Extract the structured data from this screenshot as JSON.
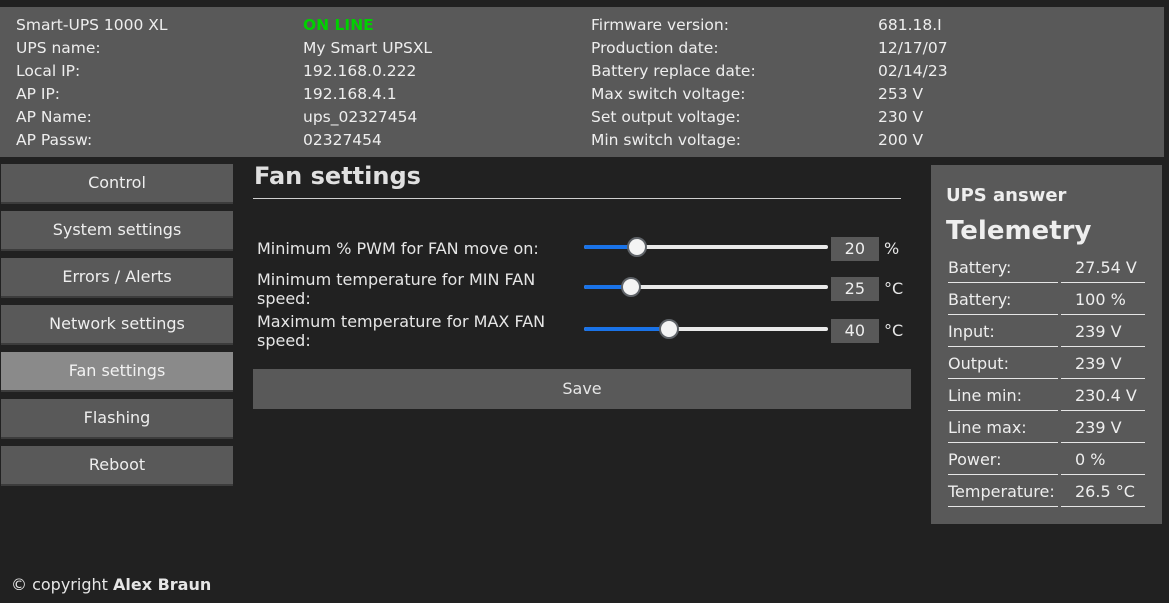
{
  "info": {
    "model": "Smart-UPS 1000 XL",
    "status": "ON LINE",
    "rows": [
      {
        "label": "UPS name:",
        "value": "My Smart UPSXL",
        "label2": "Production date:",
        "value2": "12/17/07"
      },
      {
        "label": "Local IP:",
        "value": "192.168.0.222",
        "label2": "Battery replace date:",
        "value2": "02/14/23"
      },
      {
        "label": "AP IP:",
        "value": "192.168.4.1",
        "label2": "Max switch voltage:",
        "value2": "253 V"
      },
      {
        "label": "AP Name:",
        "value": "ups_02327454",
        "label2": "Set output voltage:",
        "value2": "230 V"
      },
      {
        "label": "AP Passw:",
        "value": "02327454",
        "label2": "Min switch voltage:",
        "value2": "200 V"
      }
    ],
    "firmware_label": "Firmware version:",
    "firmware_value": "681.18.I"
  },
  "menu": [
    {
      "label": "Control"
    },
    {
      "label": "System settings"
    },
    {
      "label": "Errors / Alerts"
    },
    {
      "label": "Network settings"
    },
    {
      "label": "Fan settings",
      "active": true
    },
    {
      "label": "Flashing"
    },
    {
      "label": "Reboot"
    }
  ],
  "fan": {
    "title": "Fan settings",
    "settings": [
      {
        "label": "Minimum % PWM for FAN move on:",
        "value": "20",
        "unit": "%",
        "fraction": 0.217
      },
      {
        "label": "Minimum temperature for MIN FAN speed:",
        "value": "25",
        "unit": "°C",
        "fraction": 0.193
      },
      {
        "label": "Maximum temperature for MAX FAN speed:",
        "value": "40",
        "unit": "°C",
        "fraction": 0.348
      }
    ],
    "save_label": "Save"
  },
  "telemetry": {
    "heading": "UPS answer",
    "title": "Telemetry",
    "rows": [
      {
        "k": "Battery:",
        "v": "27.54 V"
      },
      {
        "k": "Battery:",
        "v": "100 %"
      },
      {
        "k": "Input:",
        "v": "239 V"
      },
      {
        "k": "Output:",
        "v": "239 V"
      },
      {
        "k": "Line min:",
        "v": "230.4 V"
      },
      {
        "k": "Line max:",
        "v": "239 V"
      },
      {
        "k": "Power:",
        "v": "0 %"
      },
      {
        "k": "Temperature:",
        "v": "26.5 °C"
      }
    ]
  },
  "footer": {
    "prefix": "© copyright",
    "author": "Alex Braun"
  },
  "colors": {
    "panel": "#595959",
    "background": "#212121",
    "online": "#00d000",
    "slider_accent": "#1a73e8"
  }
}
